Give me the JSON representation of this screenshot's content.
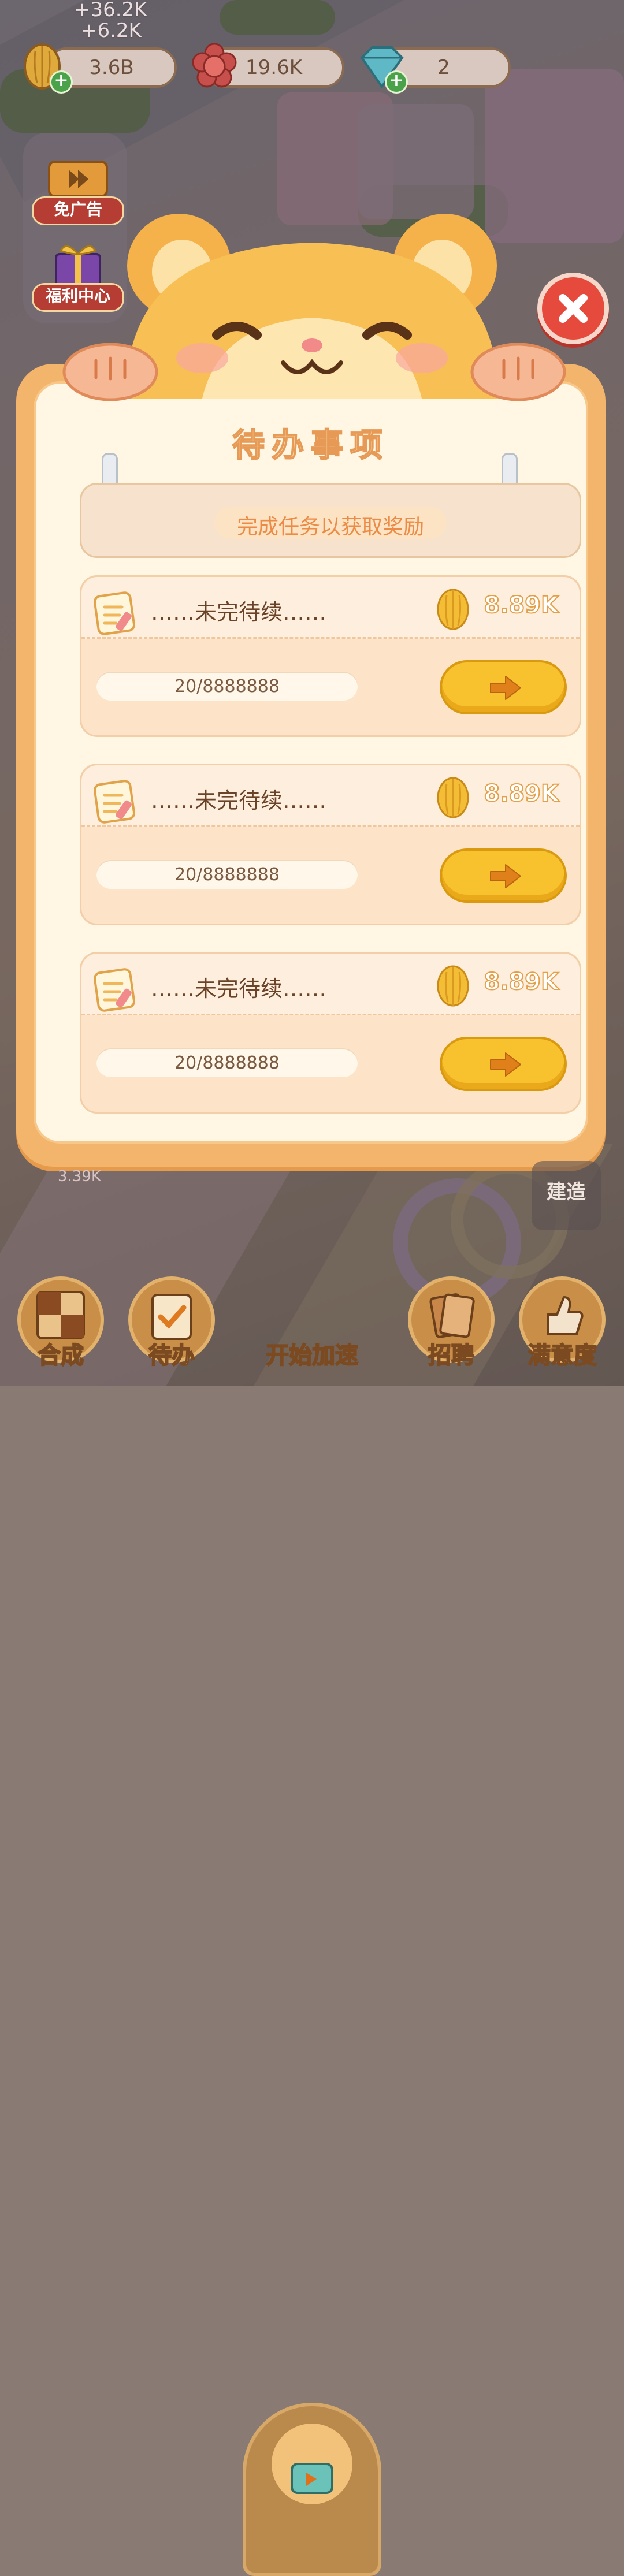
{
  "resources": {
    "floating_gain_1": "+36.2K",
    "floating_gain_2": "+6.2K",
    "seeds": "3.6B",
    "flowers": "19.6K",
    "diamonds": "2"
  },
  "side_buttons": {
    "ad_free": "免广告",
    "welfare": "福利中心"
  },
  "dialog": {
    "title": "待办事项",
    "banner": "完成任务以获取奖励",
    "tasks": [
      {
        "name": "……未完待续……",
        "reward": "8.89K",
        "progress": "20/8888888"
      },
      {
        "name": "……未完待续……",
        "reward": "8.89K",
        "progress": "20/8888888"
      },
      {
        "name": "……未完待续……",
        "reward": "8.89K",
        "progress": "20/8888888"
      }
    ]
  },
  "background": {
    "build_label": "建造",
    "faded_value": "3.39K"
  },
  "nav": {
    "merge": "合成",
    "todo": "待办",
    "speed_up": "开始加速",
    "recruit": "招聘",
    "satisfaction": "满意度"
  },
  "colors": {
    "dialog_frame": "#f3b46c",
    "dialog_paper": "#fff6e4",
    "go_button": "#f8c22e",
    "close_button": "#e54a3c",
    "reward_text_stroke": "#e3a048"
  },
  "icons": {
    "seed": "sunflower-seed-icon",
    "flower": "red-flower-icon",
    "diamond": "diamond-icon",
    "task": "notepad-pencil-icon",
    "go": "arrow-right-icon",
    "close": "close-icon"
  }
}
